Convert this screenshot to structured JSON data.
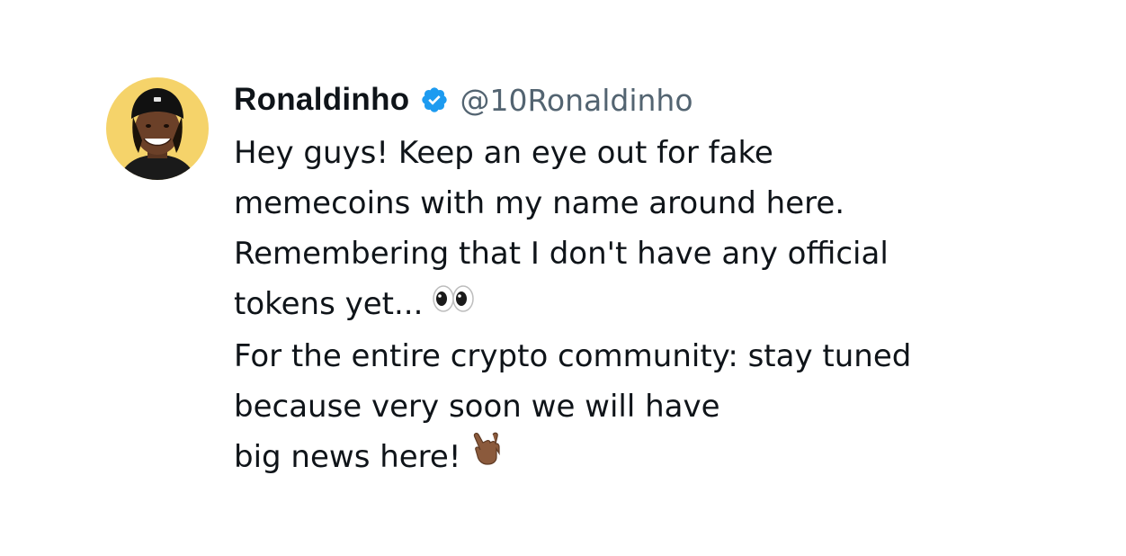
{
  "tweet": {
    "author_name": "Ronaldinho",
    "handle": "@10Ronaldinho",
    "verified_icon": "verified-badge-icon",
    "verified_color": "#1d9bf0",
    "lines": [
      "Hey guys! Keep an eye out for fake",
      "memecoins with my name around here.",
      "Remembering that I don't have any official",
      "tokens yet...",
      "For the entire crypto community: stay tuned",
      "because very soon we will have",
      "big news here!"
    ],
    "emojis": {
      "eyes": "eyes-emoji",
      "call_me_hand": "call-me-hand-emoji"
    },
    "avatar_bg": "#f5d36a"
  }
}
